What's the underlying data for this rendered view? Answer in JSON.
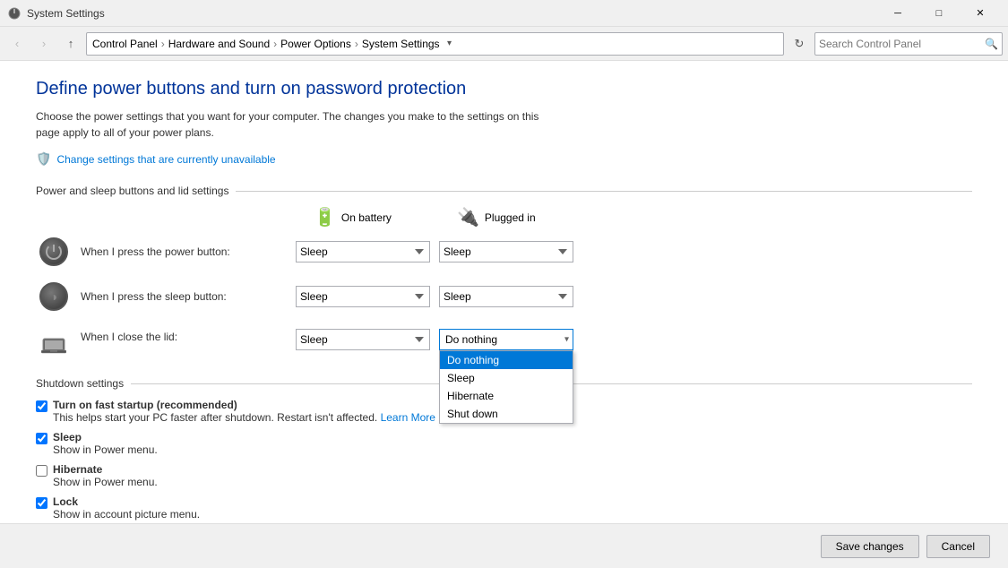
{
  "titlebar": {
    "title": "System Settings",
    "min_label": "─",
    "max_label": "□",
    "close_label": "✕"
  },
  "addressbar": {
    "back_btn": "‹",
    "forward_btn": "›",
    "up_btn": "↑",
    "breadcrumbs": [
      {
        "label": "Control Panel"
      },
      {
        "label": "Hardware and Sound"
      },
      {
        "label": "Power Options"
      },
      {
        "label": "System Settings"
      }
    ],
    "search_placeholder": "Search Control Panel"
  },
  "page": {
    "title": "Define power buttons and turn on password protection",
    "description": "Choose the power settings that you want for your computer. The changes you make to the settings on this page apply to all of your power plans.",
    "change_link": "Change settings that are currently unavailable",
    "section_power": "Power and sleep buttons and lid settings",
    "col_battery": "On battery",
    "col_plugged": "Plugged in",
    "rows": [
      {
        "label": "When I press the power button:",
        "icon_type": "power",
        "battery_value": "Sleep",
        "plugged_value": "Sleep"
      },
      {
        "label": "When I press the sleep button:",
        "icon_type": "sleep",
        "battery_value": "Sleep",
        "plugged_value": "Sleep"
      },
      {
        "label": "When I close the lid:",
        "icon_type": "lid",
        "battery_value": "Sleep",
        "plugged_value": "Do nothing",
        "plugged_open": true
      }
    ],
    "dropdown_options": [
      "Do nothing",
      "Sleep",
      "Hibernate",
      "Shut down"
    ],
    "dropdown_selected": "Do nothing",
    "section_shutdown": "Shutdown settings",
    "checkboxes": [
      {
        "id": "fast_startup",
        "checked": true,
        "label": "Turn on fast startup (recommended)",
        "sublabel": "This helps start your PC faster after shutdown. Restart isn't affected.",
        "link": "Learn More",
        "grayed": false
      },
      {
        "id": "sleep",
        "checked": true,
        "label": "Sleep",
        "sublabel": "Show in Power menu.",
        "grayed": false
      },
      {
        "id": "hibernate",
        "checked": false,
        "label": "Hibernate",
        "sublabel": "Show in Power menu.",
        "grayed": false
      },
      {
        "id": "lock",
        "checked": true,
        "label": "Lock",
        "sublabel": "Show in account picture menu.",
        "grayed": false
      }
    ]
  },
  "footer": {
    "save_label": "Save changes",
    "cancel_label": "Cancel"
  }
}
